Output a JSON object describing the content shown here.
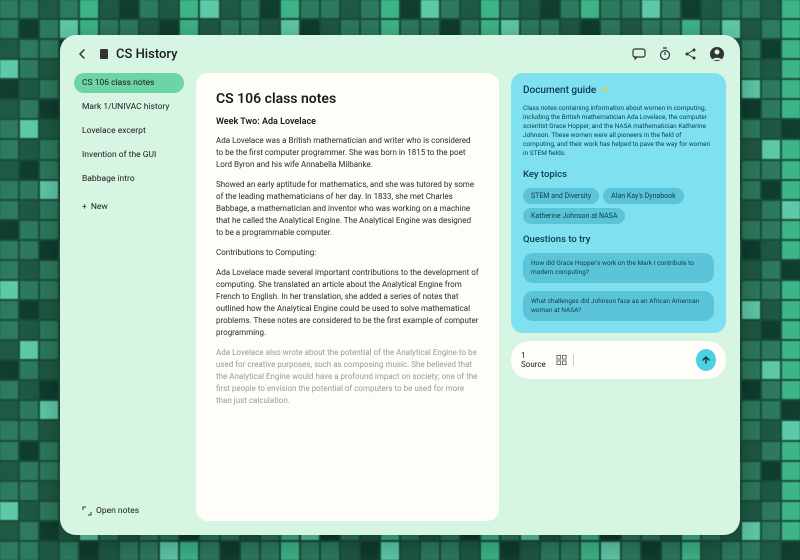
{
  "header": {
    "title": "CS History"
  },
  "sidebar": {
    "items": [
      {
        "label": "CS 106 class notes"
      },
      {
        "label": "Mark 1/UNIVAC history"
      },
      {
        "label": "Lovelace excerpt"
      },
      {
        "label": "Invention of the GUI"
      },
      {
        "label": "Babbage intro"
      }
    ],
    "new_label": "New",
    "open_notes": "Open notes"
  },
  "document": {
    "title": "CS 106 class notes",
    "subtitle": "Week Two: Ada Lovelace",
    "p1": "Ada Lovelace was a British mathematician and writer who is considered to be the first computer programmer. She was born in 1815 to the poet Lord Byron and his wife Annabella Milbanke.",
    "p2": "Showed an early aptitude for mathematics, and she was tutored by some of the leading mathematicians of her day. In 1833, she met Charles Babbage, a mathematician and inventor who was working on a machine that he called the Analytical Engine. The Analytical Engine was designed to be a programmable computer.",
    "p3": "Contributions to Computing:",
    "p4": "Ada Lovelace made several important contributions to the development of computing. She translated an article about the Analytical Engine from French to English. In her translation, she added a series of notes that outlined how the Analytical Engine could be used to solve mathematical problems. These notes are considered to be the first example of computer programming.",
    "p5": "Ada Lovelace also wrote about the potential of the Analytical Engine to be used for creative purposes, such as composing music. She believed that the Analytical Engine would have a profound impact on society; one of the first people to envision the potential of computers to be used for more than just calculation."
  },
  "guide": {
    "title": "Document guide",
    "description": "Class notes containing information about women in computing, including the British mathematician Ada Lovelace, the computer scientist Grace Hopper, and the NASA mathematician Katherine Johnson. These women were all pioneers in the field of computing, and their work has helped to pave the way for women in STEM fields.",
    "topics_label": "Key topics",
    "topics": [
      "STEM and Diversity",
      "Alan Kay's Dynabook",
      "Katherine Johnson at NASA"
    ],
    "questions_label": "Questions to try",
    "questions": [
      "How did Grace Hopper's work on the Mark I contribute to modern computing?",
      "What challenges did Johnson face as an African American woman at NASA?"
    ]
  },
  "input": {
    "source_label": "1 Source",
    "placeholder": ""
  }
}
